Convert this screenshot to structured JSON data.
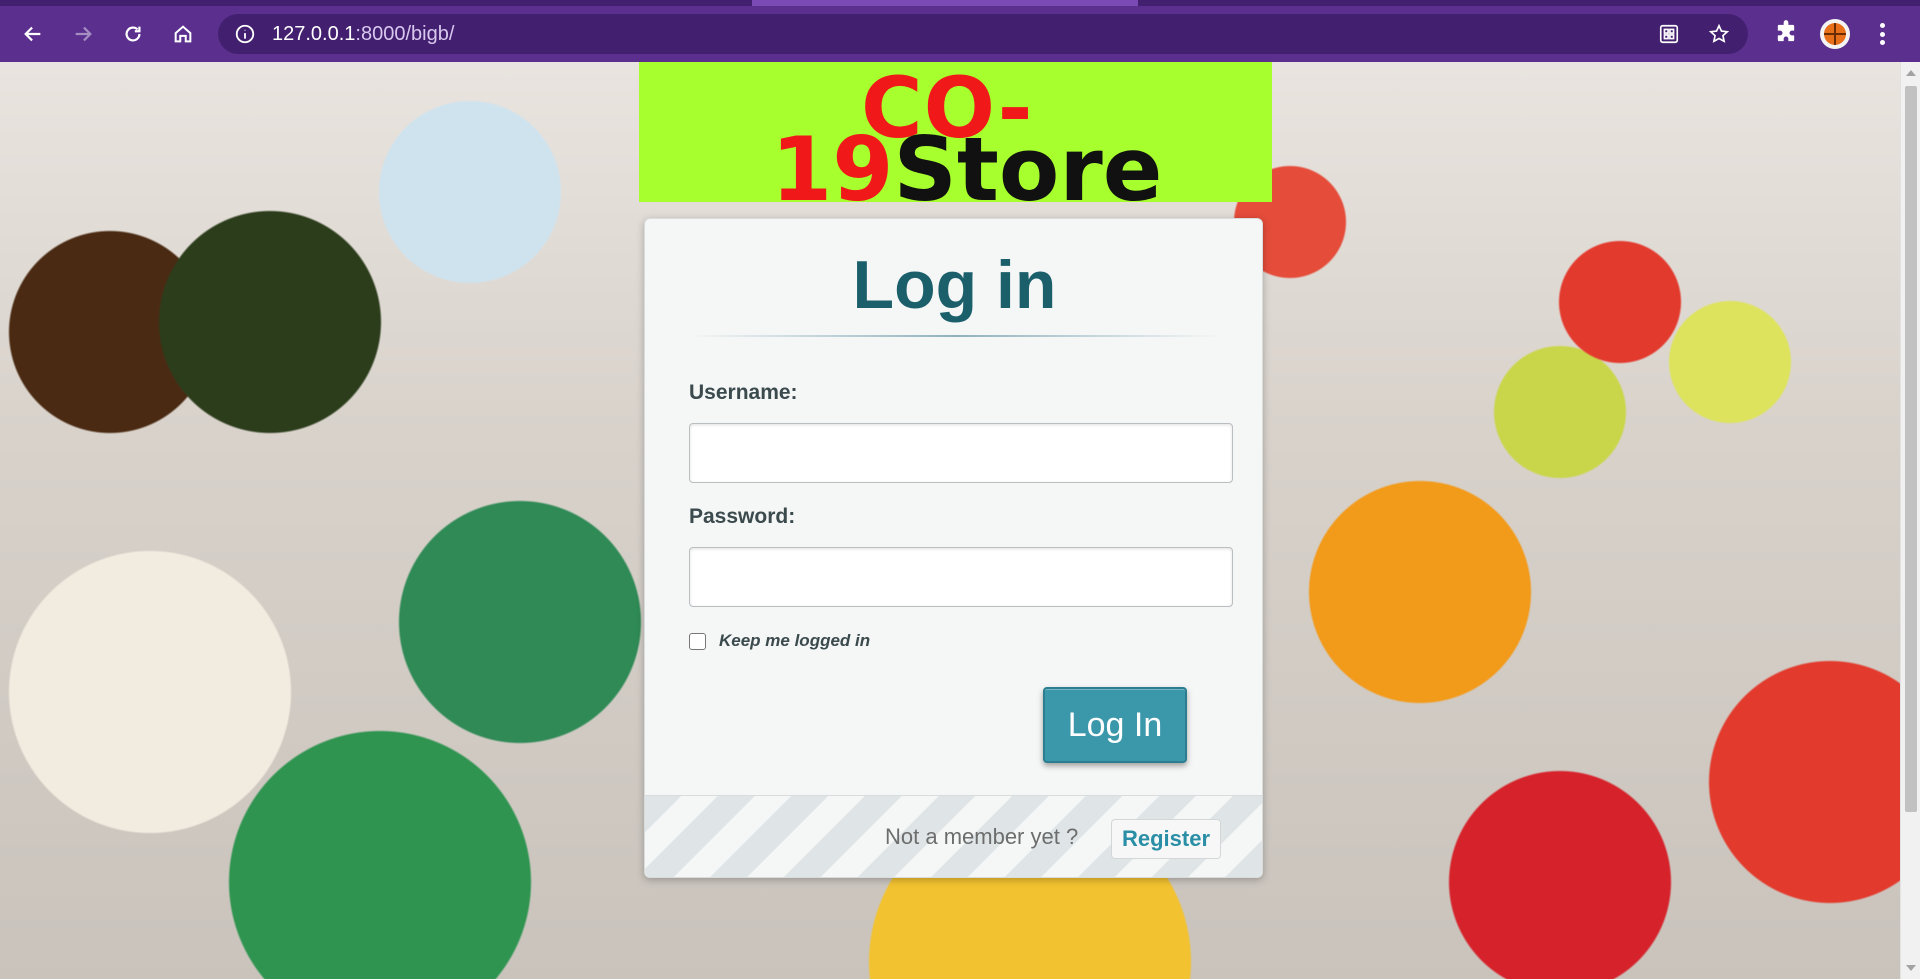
{
  "browser": {
    "url_host": "127.0.0.1",
    "url_path": ":8000/bigb/",
    "icons": {
      "back": "arrow-left-icon",
      "forward": "arrow-right-icon",
      "reload": "reload-icon",
      "home": "home-icon",
      "site_info": "info-icon",
      "install": "app-install-icon",
      "bookmark": "star-icon",
      "extensions": "puzzle-icon",
      "profile": "basketball-avatar",
      "menu": "kebab-menu-icon"
    },
    "theme_color": "#5a2f8e"
  },
  "logo": {
    "line1": "CO-",
    "line2_number": "19",
    "line2_word": "Store",
    "background": "#a8ff2e",
    "accent": "#f01818"
  },
  "login": {
    "title": "Log in",
    "username_label": "Username:",
    "username_value": "",
    "password_label": "Password:",
    "password_value": "",
    "keep_logged_in_label": "Keep me logged in",
    "keep_logged_in_checked": false,
    "submit_label": "Log In",
    "footer_text": "Not a member yet ?",
    "register_label": "Register",
    "accent_color": "#3a98aa"
  }
}
